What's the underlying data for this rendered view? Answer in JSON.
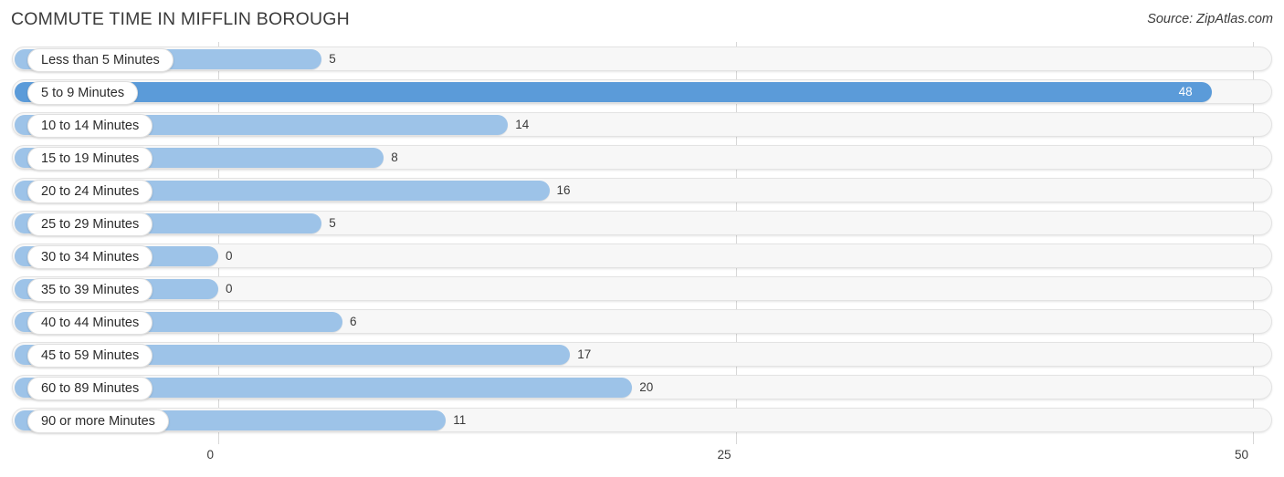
{
  "header": {
    "title": "COMMUTE TIME IN MIFFLIN BOROUGH",
    "source": "Source: ZipAtlas.com"
  },
  "colors": {
    "bar": "#9dc3e8",
    "bar_highlight": "#5b9bd9",
    "track": "#f7f7f7",
    "gridline": "#d8d8d8",
    "text": "#3b3b3b"
  },
  "chart_data": {
    "type": "bar",
    "orientation": "horizontal",
    "title": "COMMUTE TIME IN MIFFLIN BOROUGH",
    "xlabel": "",
    "ylabel": "",
    "xlim": [
      0,
      50
    ],
    "xticks": [
      0,
      25,
      50
    ],
    "xtick_labels": [
      "0",
      "25",
      "50"
    ],
    "grid": true,
    "legend": false,
    "highlight_category": "5 to 9 Minutes",
    "categories": [
      "Less than 5 Minutes",
      "5 to 9 Minutes",
      "10 to 14 Minutes",
      "15 to 19 Minutes",
      "20 to 24 Minutes",
      "25 to 29 Minutes",
      "30 to 34 Minutes",
      "35 to 39 Minutes",
      "40 to 44 Minutes",
      "45 to 59 Minutes",
      "60 to 89 Minutes",
      "90 or more Minutes"
    ],
    "values": [
      5,
      48,
      14,
      8,
      16,
      5,
      0,
      0,
      6,
      17,
      20,
      11
    ],
    "value_labels": [
      "5",
      "48",
      "14",
      "8",
      "16",
      "5",
      "0",
      "0",
      "6",
      "17",
      "20",
      "11"
    ]
  }
}
